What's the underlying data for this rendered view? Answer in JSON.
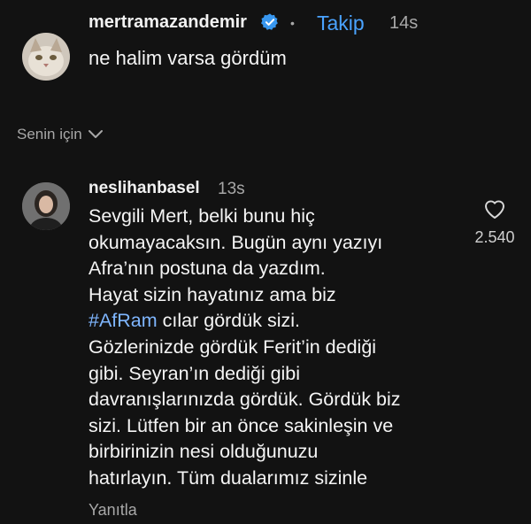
{
  "comment1": {
    "username": "mertramazandemir",
    "dot": "•",
    "follow": "Takip",
    "time": "14s",
    "text": "ne halim varsa gördüm"
  },
  "section": {
    "label": "Senin için"
  },
  "comment2": {
    "username": "neslihanbasel",
    "time": "13s",
    "lines_before": "Sevgili Mert, belki bunu hiç\nokumayacaksın. Bugün aynı yazıyı\nAfra’nın postuna da yazdım.\nHayat sizin hayatınız ama biz\n",
    "hashtag": "#AfRam",
    "lines_after": " cılar gördük sizi.\nGözlerinizde gördük Ferit’in dediği\ngibi. Seyran’ın dediği gibi\ndavranışlarınızda gördük. Gördük biz\nsizi. Lütfen bir an önce sakinleşin ve\nbirbirinizin nesi olduğunuzu\nhatırlayın. Tüm dualarımız sizinle",
    "likes": "2.540",
    "reply": "Yanıtla"
  },
  "colors": {
    "background": "#121212",
    "link": "#4aa3ff",
    "hashtag": "#7fb6ff",
    "verified": "#3897f0"
  }
}
